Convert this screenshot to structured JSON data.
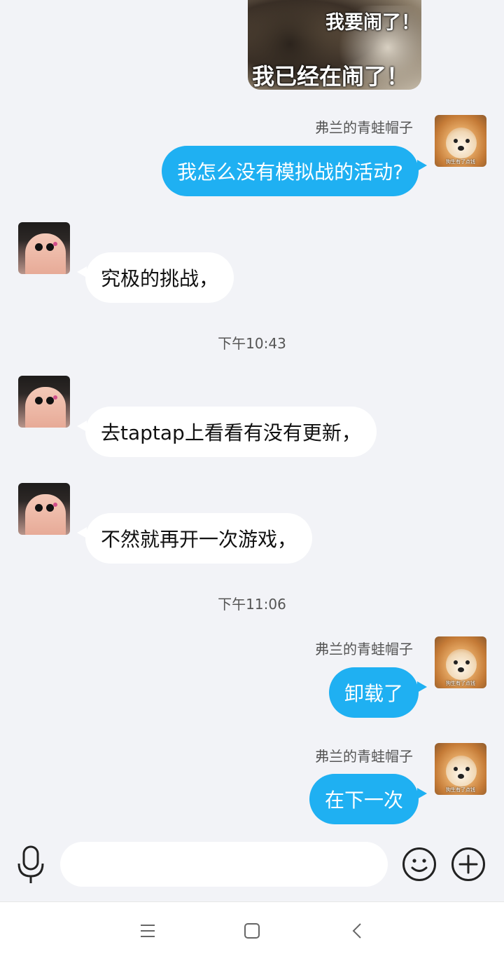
{
  "sticker": {
    "caption_top": "我要闹了！",
    "caption_bottom": "我已经在闹了！"
  },
  "messages": [
    {
      "sender": "弗兰的青蛙帽子",
      "text": "我怎么没有模拟战的活动?"
    },
    {
      "text": "究极的挑战，"
    },
    {
      "text": "去taptap上看看有没有更新，"
    },
    {
      "text": "不然就再开一次游戏，"
    },
    {
      "sender": "弗兰的青蛙帽子",
      "text": "卸载了"
    },
    {
      "sender": "弗兰的青蛙帽子",
      "text": "在下一次"
    }
  ],
  "timestamps": [
    "下午10:43",
    "下午11:06"
  ],
  "avatar_caption": "狗生有了点钱",
  "input": {
    "placeholder": "",
    "value": ""
  },
  "icons": {
    "mic": "microphone-icon",
    "emoji": "smiley-icon",
    "plus": "plus-icon",
    "menu": "menu-icon",
    "home": "home-icon",
    "back": "back-icon"
  },
  "colors": {
    "background": "#f2f3f7",
    "outgoing_bubble": "#1fb0f2",
    "incoming_bubble": "#ffffff"
  }
}
